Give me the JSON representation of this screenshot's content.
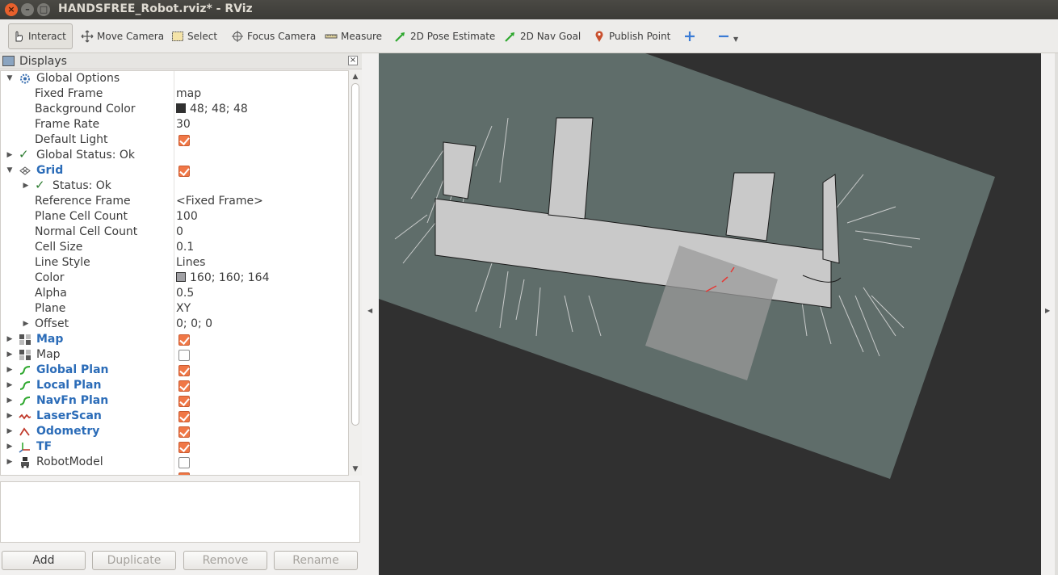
{
  "window": {
    "title": "HANDSFREE_Robot.rviz* - RViz"
  },
  "toolbar": {
    "interact": "Interact",
    "move_camera": "Move Camera",
    "select": "Select",
    "focus_camera": "Focus Camera",
    "measure": "Measure",
    "pose_estimate": "2D Pose Estimate",
    "nav_goal": "2D Nav Goal",
    "publish_point": "Publish Point"
  },
  "displays": {
    "title": "Displays",
    "global_options": "Global Options",
    "fixed_frame_label": "Fixed Frame",
    "fixed_frame_value": "map",
    "background_color_label": "Background Color",
    "background_color_value": "48; 48; 48",
    "frame_rate_label": "Frame Rate",
    "frame_rate_value": "30",
    "default_light_label": "Default Light",
    "global_status": "Global Status: Ok",
    "grid": "Grid",
    "grid_status": "Status: Ok",
    "reference_frame_label": "Reference Frame",
    "reference_frame_value": "<Fixed Frame>",
    "plane_cell_count_label": "Plane Cell Count",
    "plane_cell_count_value": "100",
    "normal_cell_count_label": "Normal Cell Count",
    "normal_cell_count_value": "0",
    "cell_size_label": "Cell Size",
    "cell_size_value": "0.1",
    "line_style_label": "Line Style",
    "line_style_value": "Lines",
    "color_label": "Color",
    "color_value": "160; 160; 164",
    "alpha_label": "Alpha",
    "alpha_value": "0.5",
    "plane_label": "Plane",
    "plane_value": "XY",
    "offset_label": "Offset",
    "offset_value": "0; 0; 0",
    "items": [
      {
        "label": "Map",
        "checked": true
      },
      {
        "label": "Map",
        "checked": false
      },
      {
        "label": "Global Plan",
        "checked": true
      },
      {
        "label": "Local Plan",
        "checked": true
      },
      {
        "label": "NavFn Plan",
        "checked": true
      },
      {
        "label": "LaserScan",
        "checked": true
      },
      {
        "label": "Odometry",
        "checked": true
      },
      {
        "label": "TF",
        "checked": true
      },
      {
        "label": "RobotModel",
        "checked": false
      }
    ],
    "colors": {
      "background_swatch": "#303030",
      "grid_swatch": "#a0a0a4",
      "checkbox_on": "#f07746",
      "link_blue": "#2b6cb8"
    }
  },
  "buttons": {
    "add": "Add",
    "duplicate": "Duplicate",
    "remove": "Remove",
    "rename": "Rename"
  },
  "viewport": {
    "background": "#303030",
    "grid_plane": "#5f6d6a",
    "map_free": "#c9c9c9"
  }
}
